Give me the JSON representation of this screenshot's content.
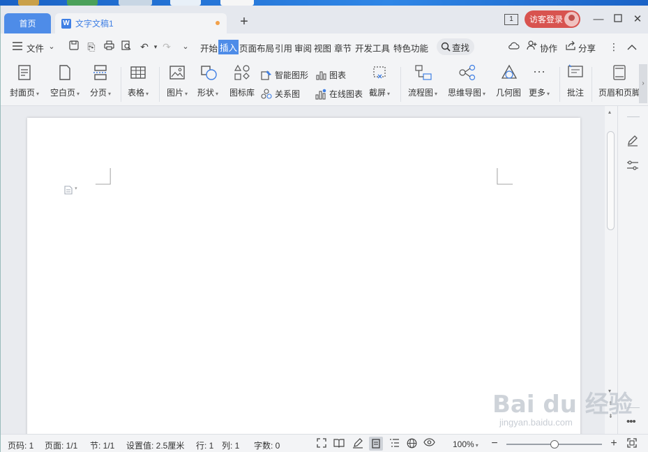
{
  "tabs": {
    "home": "首页",
    "doc_title": "文字文稿1",
    "doc_badge": "W",
    "window_count": "1",
    "guest_login": "访客登录"
  },
  "menu": {
    "file": "文件",
    "items": [
      "开始",
      "插入",
      "页面布局",
      "引用",
      "审阅",
      "视图",
      "章节",
      "开发工具",
      "特色功能"
    ],
    "active": "插入",
    "search": "查找",
    "collaborate": "协作",
    "share": "分享"
  },
  "ribbon": {
    "cover": "封面页",
    "blank_page": "空白页",
    "page_break": "分页",
    "table": "表格",
    "picture": "图片",
    "shape": "形状",
    "icon_library": "图标库",
    "smart_shape": "智能图形",
    "chart": "图表",
    "relation": "关系图",
    "online_chart": "在线图表",
    "screenshot": "截屏",
    "flowchart": "流程图",
    "mindmap": "思维导图",
    "geometry": "几何图",
    "more": "更多",
    "comment": "批注",
    "header_footer": "页眉和页脚"
  },
  "status": {
    "page_num": "页码: 1",
    "pages": "页面: 1/1",
    "section": "节: 1/1",
    "setting": "设置值: 2.5厘米",
    "row": "行: 1",
    "col": "列: 1",
    "word_count": "字数: 0",
    "zoom": "100%",
    "zoom_level": 0.5
  },
  "watermark": {
    "main": "Bai du 经验",
    "sub": "jingyan.baidu.com"
  },
  "colors": {
    "accent": "#4e8ce8",
    "guest": "#d8534f",
    "unsaved_dot": "#f2a14b"
  }
}
